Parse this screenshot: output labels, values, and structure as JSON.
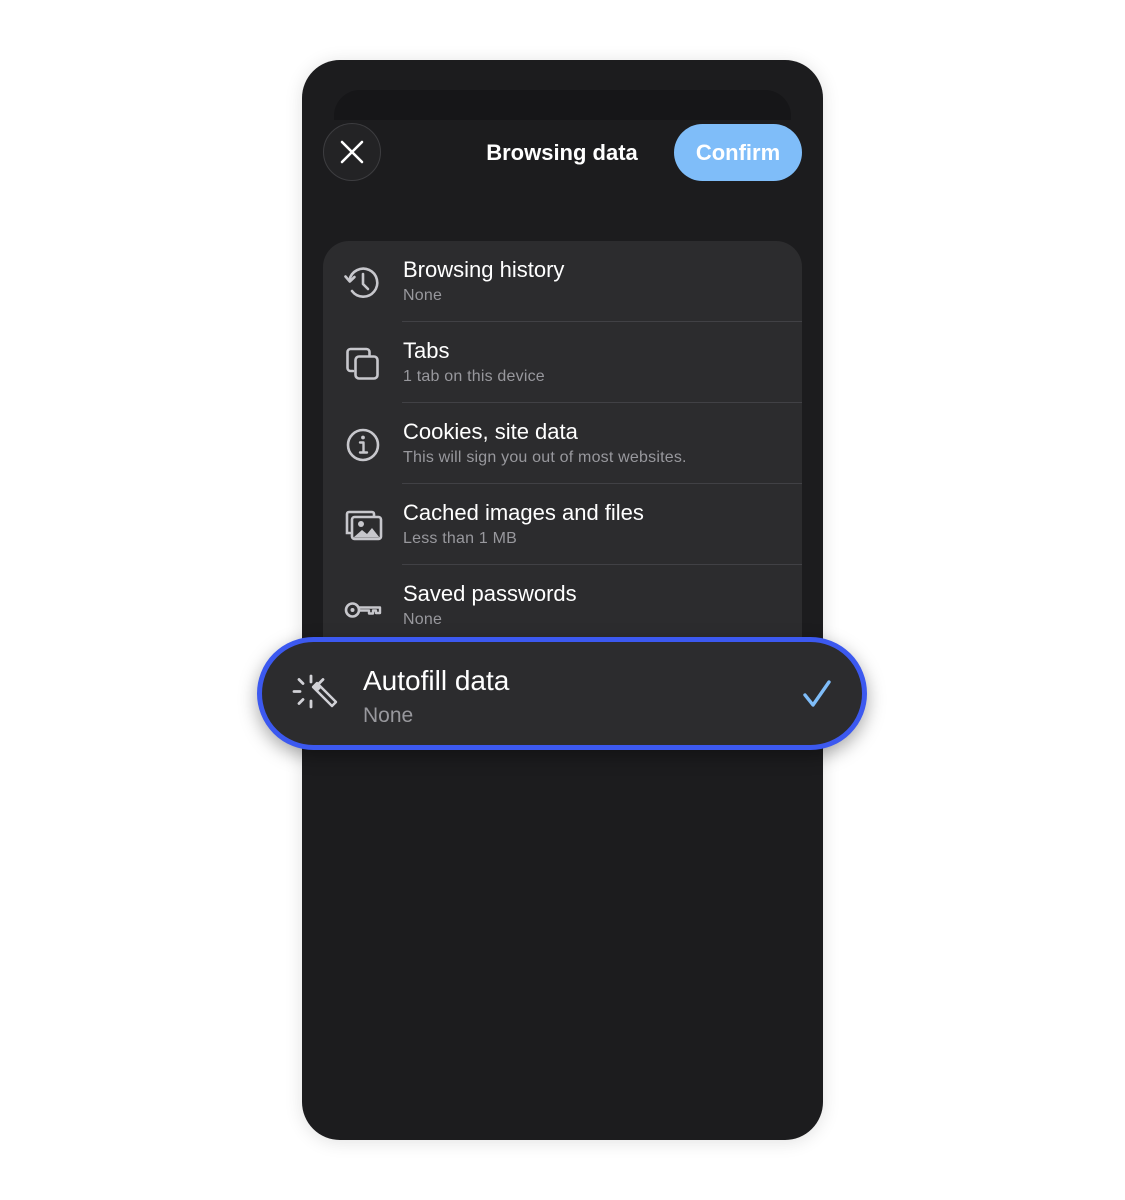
{
  "header": {
    "title": "Browsing data",
    "confirm_label": "Confirm",
    "close_icon": "close-icon"
  },
  "items": [
    {
      "label": "Browsing history",
      "detail": "None",
      "icon": "history-icon"
    },
    {
      "label": "Tabs",
      "detail": "1 tab on this device",
      "icon": "tabs-icon"
    },
    {
      "label": "Cookies, site data",
      "detail": "This will sign you out of most websites.",
      "icon": "info-icon"
    },
    {
      "label": "Cached images and files",
      "detail": "Less than 1 MB",
      "icon": "images-icon"
    },
    {
      "label": "Saved passwords",
      "detail": "None",
      "icon": "key-icon"
    }
  ],
  "highlighted_item": {
    "label": "Autofill data",
    "detail": "None",
    "icon": "magic-wand-icon",
    "checked": true
  },
  "colors": {
    "accent": "#7fbdf9",
    "highlight_border": "#3c59f0",
    "checkmark": "#7fbdf9",
    "sheet_background": "#1c1c1e",
    "list_background": "#2c2c2e"
  }
}
